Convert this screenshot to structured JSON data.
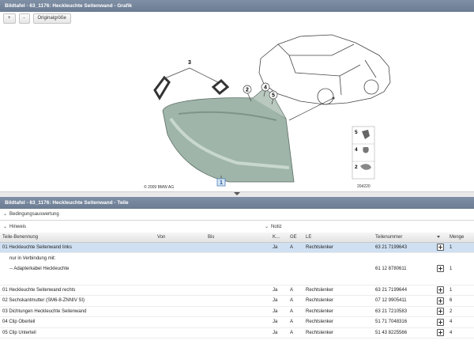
{
  "graphic_panel": {
    "title": "Bildtafel - 63_1176: Heckleuchte Seitenwand - Grafik",
    "toolbar": {
      "zoom_in": "+",
      "zoom_out": "-",
      "original_size": "Originalgröße"
    },
    "callouts": [
      "1",
      "2",
      "3",
      "4",
      "5"
    ],
    "thumbs": [
      "5",
      "4",
      "2"
    ],
    "copyright": "© 2009 BMW AG",
    "image_number": "204220"
  },
  "parts_panel": {
    "title": "Bildtafel - 63_1176: Heckleuchte Seitenwand - Teile",
    "condition_section": "Bedingungsauswertung",
    "hinweis_section": "Hinweis",
    "notiz_section": "Notiz",
    "columns": [
      "Teile-Benennung",
      "Von",
      "Bis",
      "K...",
      "GE",
      "LE",
      "Teilenummer",
      "Menge"
    ],
    "rows": [
      {
        "name": "01 Heckleuchte Seitenwand links",
        "k": "Ja",
        "ge": "A",
        "le": "Rechtslenker",
        "part": "63 21 7199643",
        "qty": "1",
        "selected": true,
        "cart": true
      },
      {
        "name": "nur in Verbindung mit:",
        "k": "",
        "ge": "",
        "le": "",
        "part": "",
        "qty": "",
        "note": true
      },
      {
        "name": "-- Adapterkabel Heckleuchte",
        "k": "",
        "ge": "",
        "le": "",
        "part": "61 12 8780611",
        "qty": "1",
        "note": true,
        "cart": true
      },
      {
        "name": "",
        "k": "",
        "ge": "",
        "le": "",
        "part": "",
        "qty": ""
      },
      {
        "name": "01 Heckleuchte Seitenwand rechts",
        "k": "Ja",
        "ge": "A",
        "le": "Rechtslenker",
        "part": "63 21 7199644",
        "qty": "1",
        "cart": true
      },
      {
        "name": "02 Sechskantmutter (SM6-8-ZNNIV SI)",
        "k": "Ja",
        "ge": "A",
        "le": "Rechtslenker",
        "part": "07 12 9905411",
        "qty": "6",
        "cart": true
      },
      {
        "name": "03 Dichtungen Heckleuchte Seitenwand",
        "k": "Ja",
        "ge": "A",
        "le": "Rechtslenker",
        "part": "63 21 7210583",
        "qty": "2",
        "cart": true
      },
      {
        "name": "04 Clip Oberteil",
        "k": "Ja",
        "ge": "A",
        "le": "Rechtslenker",
        "part": "51 71 7048316",
        "qty": "4",
        "cart": true
      },
      {
        "name": "05 Clip Unterteil",
        "k": "Ja",
        "ge": "A",
        "le": "Rechtslenker",
        "part": "51 43 8225566",
        "qty": "4",
        "cart": true
      }
    ]
  }
}
